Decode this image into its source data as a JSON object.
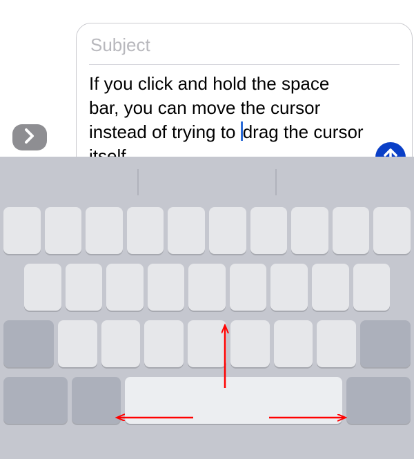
{
  "compose": {
    "subject_placeholder": "Subject",
    "body_before_cursor": "If you click and hold the space bar, you can move the cursor instead of trying to",
    "nbsp": " ",
    "body_after_cursor": "drag the cursor itself."
  },
  "icons": {
    "expand": "chevron-right",
    "send": "arrow-up"
  },
  "colors": {
    "send_bg": "#0a3fc7",
    "expand_bg": "#8e8e92",
    "keyboard_bg": "#c5c7cf",
    "key_bg": "#e6e7ea",
    "key_dark_bg": "#acb0bb",
    "arrow_annotation": "#ff0000",
    "cursor": "#2a6ad6"
  },
  "keyboard": {
    "mode": "trackpad",
    "rows": [
      10,
      9,
      9,
      5
    ]
  }
}
